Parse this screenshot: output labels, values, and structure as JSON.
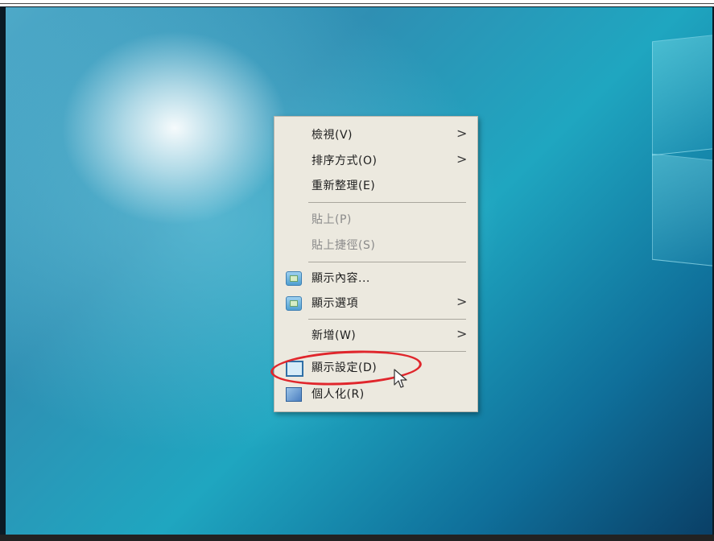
{
  "context_menu": {
    "items": [
      {
        "label": "檢視(V)",
        "has_submenu": true,
        "enabled": true,
        "icon": null
      },
      {
        "label": "排序方式(O)",
        "has_submenu": true,
        "enabled": true,
        "icon": null
      },
      {
        "label": "重新整理(E)",
        "has_submenu": false,
        "enabled": true,
        "icon": null
      },
      {
        "label": "貼上(P)",
        "has_submenu": false,
        "enabled": false,
        "icon": null
      },
      {
        "label": "貼上捷徑(S)",
        "has_submenu": false,
        "enabled": false,
        "icon": null
      },
      {
        "label": "顯示內容...",
        "has_submenu": false,
        "enabled": true,
        "icon": "display-properties-icon"
      },
      {
        "label": "顯示選項",
        "has_submenu": true,
        "enabled": true,
        "icon": "display-options-icon"
      },
      {
        "label": "新增(W)",
        "has_submenu": true,
        "enabled": true,
        "icon": null
      },
      {
        "label": "顯示設定(D)",
        "has_submenu": false,
        "enabled": true,
        "icon": "monitor-icon",
        "highlighted": true
      },
      {
        "label": "個人化(R)",
        "has_submenu": false,
        "enabled": true,
        "icon": "personalize-icon"
      }
    ],
    "submenu_arrow": ">"
  },
  "annotation": {
    "shape": "ellipse",
    "color": "#e0262c",
    "target": "顯示設定(D)"
  },
  "colors": {
    "menu_bg": "#ece9df",
    "desktop_accent": "#1fa6c0",
    "disabled_text": "#8a8a8a"
  }
}
